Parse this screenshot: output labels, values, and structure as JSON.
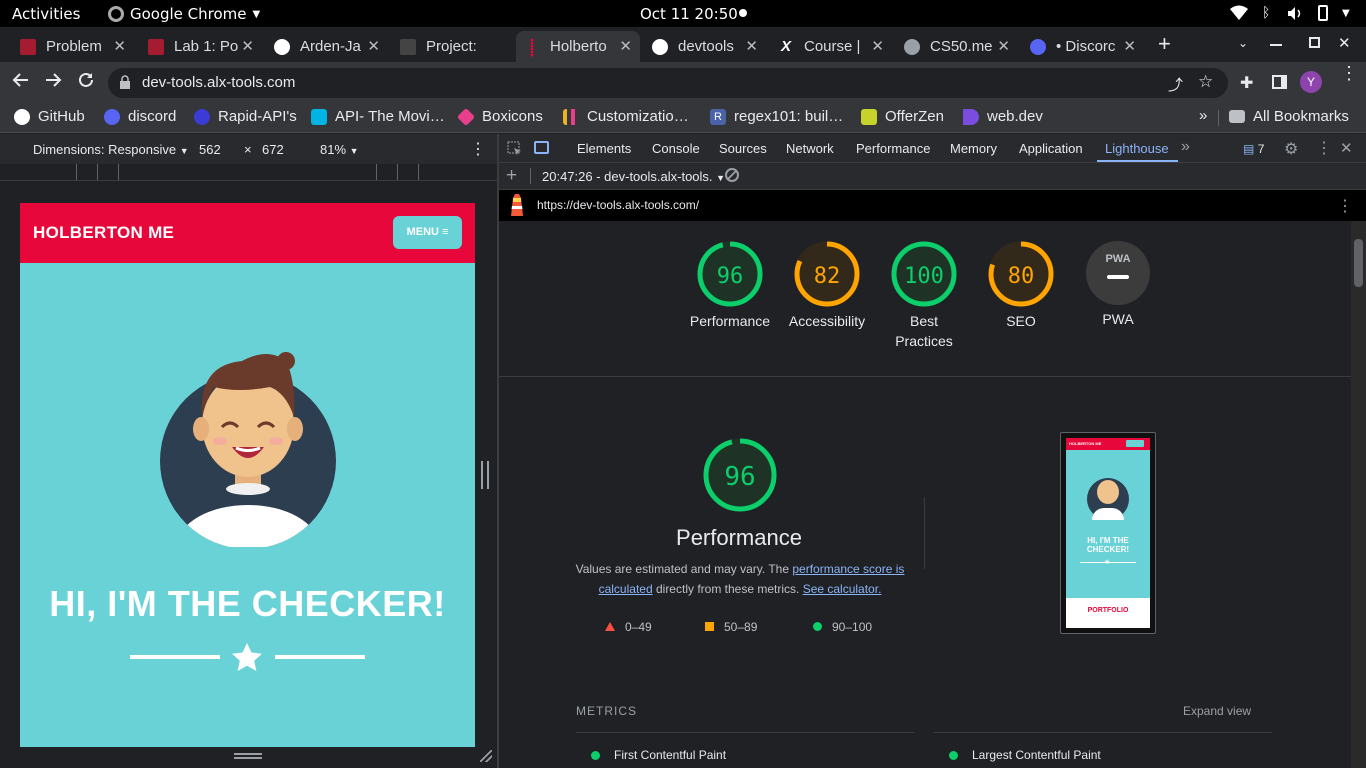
{
  "os": {
    "activities": "Activities",
    "app_name": "Google Chrome",
    "clock": "Oct 11  20:50"
  },
  "tabs": [
    {
      "title": "Problem",
      "color": "#a51c30"
    },
    {
      "title": "Lab 1: Po",
      "color": "#a51c30"
    },
    {
      "title": "Arden-Ja",
      "color": "#ffffff"
    },
    {
      "title": "Project:",
      "color": "#444444"
    },
    {
      "title": "Holberto",
      "color": "#e8073a"
    },
    {
      "title": "devtools",
      "color": "#ffffff"
    },
    {
      "title": "Course |",
      "color": "#ffffff"
    },
    {
      "title": "CS50.me",
      "color": "#9aa0a6"
    },
    {
      "title": "• Discorc",
      "color": "#5865f2"
    }
  ],
  "address": {
    "url": "dev-tools.alx-tools.com"
  },
  "profile_initial": "Y",
  "bookmarks": [
    {
      "label": "GitHub",
      "color": "#ffffff"
    },
    {
      "label": "discord",
      "color": "#5865f2"
    },
    {
      "label": "Rapid-API's",
      "color": "#3b3bd6"
    },
    {
      "label": "API- The Movi…",
      "color": "#01b4e4"
    },
    {
      "label": "Boxicons",
      "color": "#e83e8c"
    },
    {
      "label": "Customizatio…",
      "color": "#e8b321"
    },
    {
      "label": "regex101: buil…",
      "color": "#4a62a8"
    },
    {
      "label": "OfferZen",
      "color": "#ffffff"
    },
    {
      "label": "web.dev",
      "color": "#7b4ce0"
    }
  ],
  "all_bookmarks": "All Bookmarks",
  "device": {
    "dimensions_label": "Dimensions: Responsive",
    "width": "562",
    "times": "×",
    "height": "672",
    "zoom": "81%"
  },
  "site": {
    "brand": "HOLBERTON ME",
    "menu": "MENU",
    "heading": "HI, I'M THE CHECKER!",
    "thumb_footer": "PORTFOLIO",
    "thumb_heading": "HI, I'M THE CHECKER!",
    "colors": {
      "primary": "#e8073a",
      "teal": "#69d2d6",
      "navy": "#2c3e50"
    }
  },
  "devtools": {
    "tabs": [
      "Elements",
      "Console",
      "Sources",
      "Network",
      "Performance",
      "Memory",
      "Application",
      "Lighthouse"
    ],
    "active_tab": "Lighthouse",
    "issues_count": "7",
    "report_session": "20:47:26 - dev-tools.alx-tools.",
    "report_url": "https://dev-tools.alx-tools.com/"
  },
  "lighthouse": {
    "scores": [
      {
        "label": "Performance",
        "value": 96,
        "status": "pass"
      },
      {
        "label": "Accessibility",
        "value": 82,
        "status": "average"
      },
      {
        "label": "Best Practices",
        "value": 100,
        "status": "pass"
      },
      {
        "label": "SEO",
        "value": 80,
        "status": "average"
      }
    ],
    "pwa_label": "PWA",
    "pwa_badge": "PWA",
    "main": {
      "value": 96,
      "title": "Performance"
    },
    "desc_prefix": "Values are estimated and may vary. The ",
    "desc_link1": "performance score is calculated",
    "desc_mid": " directly from these metrics. ",
    "desc_link2": "See calculator.",
    "legend": [
      {
        "range": "0–49",
        "color": "#ff4e42"
      },
      {
        "range": "50–89",
        "color": "#ffa400"
      },
      {
        "range": "90–100",
        "color": "#0cce6b"
      }
    ],
    "metrics_title": "METRICS",
    "expand_view": "Expand view",
    "metric_1": "First Contentful Paint",
    "metric_2": "Largest Contentful Paint",
    "colors": {
      "pass": "#0cce6b",
      "average": "#ffa400",
      "fail": "#ff4e42"
    }
  }
}
